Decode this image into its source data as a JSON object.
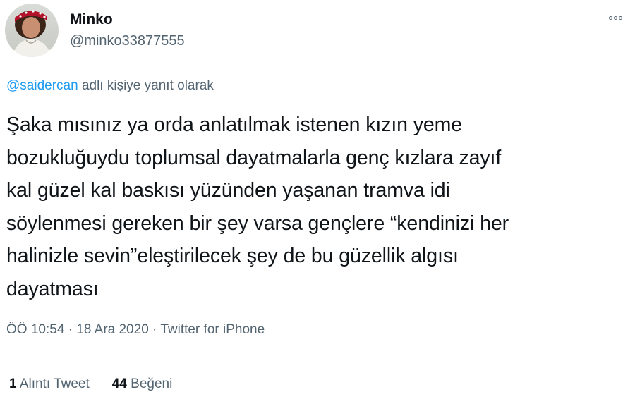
{
  "author": {
    "display_name": "Minko",
    "handle": "@minko33877555"
  },
  "more_icon": "more-horizontal-icon",
  "reply_context": {
    "mention": "@saidercan",
    "text": " adlı kişiye yanıt olarak"
  },
  "tweet_lines": [
    "Şaka mısınız ya orda anlatılmak istenen kızın yeme",
    "bozukluğuydu toplumsal dayatmalarla genç kızlara zayıf",
    "kal güzel kal baskısı yüzünden yaşanan tramva idi",
    "söylenmesi gereken bir şey varsa gençlere “kendinizi her",
    "halinizle sevin”eleştirilecek şey de bu güzellik algısı",
    "dayatması"
  ],
  "meta": {
    "time": "ÖÖ 10:54",
    "separator1": " · ",
    "date": "18 Ara 2020",
    "separator2": " · ",
    "source": "Twitter for iPhone"
  },
  "stats": {
    "quotes_count": "1",
    "quotes_label": " Alıntı Tweet",
    "likes_count": "44",
    "likes_label": " Beğeni"
  },
  "colors": {
    "accent": "#1d9bf0",
    "secondary_text": "#536471",
    "primary_text": "#0f1419",
    "divider": "#e6ecf0"
  }
}
